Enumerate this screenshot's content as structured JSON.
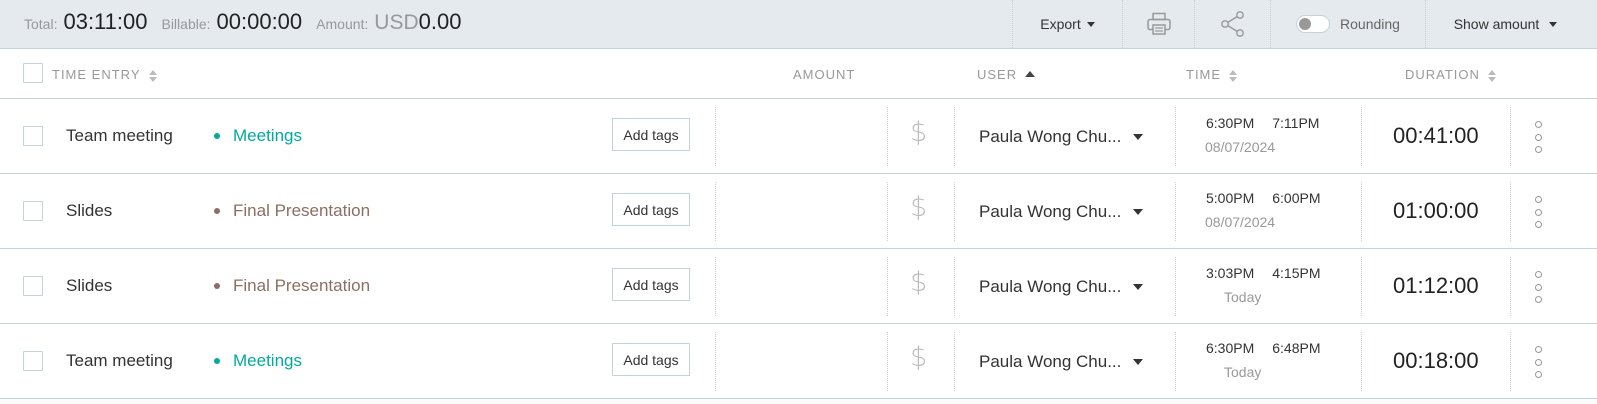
{
  "summary": {
    "total_label": "Total:",
    "total_value": "03:11:00",
    "billable_label": "Billable:",
    "billable_value": "00:00:00",
    "amount_label": "Amount:",
    "amount_currency": "USD",
    "amount_value": "0.00"
  },
  "toolbar": {
    "export_label": "Export",
    "rounding_label": "Rounding",
    "show_amount_label": "Show amount"
  },
  "columns": {
    "time_entry": "TIME ENTRY",
    "amount": "AMOUNT",
    "user": "USER",
    "time": "TIME",
    "duration": "DURATION"
  },
  "colors": {
    "meetings": "#03a9a0",
    "final_presentation": "#8d6e63"
  },
  "entries": [
    {
      "description": "Team meeting",
      "project": "Meetings",
      "project_color": "#03a9a0",
      "add_tags": "Add tags",
      "billable_icon": "dollar-icon",
      "user": "Paula Wong Chu...",
      "start": "6:30PM",
      "end": "7:11PM",
      "date": "08/07/2024",
      "duration": "00:41:00"
    },
    {
      "description": "Slides",
      "project": "Final Presentation",
      "project_color": "#8d6e63",
      "add_tags": "Add tags",
      "billable_icon": "dollar-icon",
      "user": "Paula Wong Chu...",
      "start": "5:00PM",
      "end": "6:00PM",
      "date": "08/07/2024",
      "duration": "01:00:00"
    },
    {
      "description": "Slides",
      "project": "Final Presentation",
      "project_color": "#8d6e63",
      "add_tags": "Add tags",
      "billable_icon": "dollar-icon",
      "user": "Paula Wong Chu...",
      "start": "3:03PM",
      "end": "4:15PM",
      "date": "Today",
      "duration": "01:12:00"
    },
    {
      "description": "Team meeting",
      "project": "Meetings",
      "project_color": "#03a9a0",
      "add_tags": "Add tags",
      "billable_icon": "dollar-icon",
      "user": "Paula Wong Chu...",
      "start": "6:30PM",
      "end": "6:48PM",
      "date": "Today",
      "duration": "00:18:00"
    }
  ]
}
